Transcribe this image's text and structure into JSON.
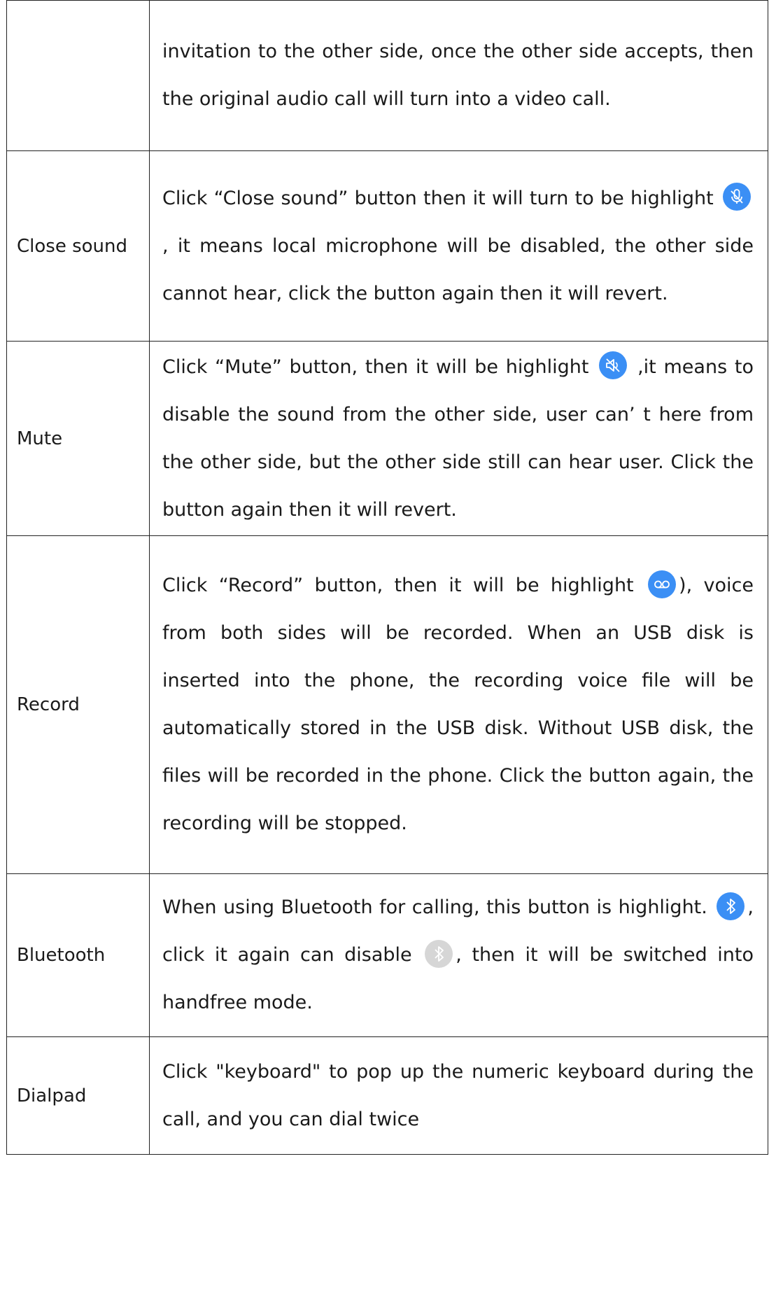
{
  "rows": [
    {
      "feature": "",
      "text": "invitation to the other side, once the other side accepts, then the original audio call will turn into a video call."
    },
    {
      "feature": "Close sound",
      "text_before": "Click “Close sound” button then it will turn to be highlight",
      "text_after": ", it means local microphone will be disabled, the other side cannot hear, click the button again then it will revert."
    },
    {
      "feature": "Mute",
      "text_before": "Click  “Mute” button, then it will be highlight",
      "text_after": ",it means to disable the sound from the other side, user can’ t here from the other side, but the other side still can hear user. Click the button again then it will revert."
    },
    {
      "feature": "Record",
      "text_before": "Click  “Record” button, then it will be highlight",
      "text_after": "), voice from both sides will be recorded. When an USB disk is inserted into the phone, the recording voice file will be automatically stored in the USB disk. Without USB disk, the files will be recorded in the phone. Click the button again, the recording will be stopped."
    },
    {
      "feature": "Bluetooth",
      "text_before": "When using Bluetooth for calling, this button is highlight.",
      "text_middle": ", click it again can disable",
      "text_after": ", then it will be switched into handfree mode."
    },
    {
      "feature": "Dialpad",
      "text": "Click \"keyboard\" to pop up the numeric keyboard during the call, and you can dial twice"
    }
  ],
  "icons": {
    "close_sound": "mic-off-icon",
    "mute": "speaker-mute-icon",
    "record": "voicemail-icon",
    "bluetooth_on": "bluetooth-icon",
    "bluetooth_off": "bluetooth-icon",
    "highlight_color": "#3b8ff5",
    "disabled_color": "#d6d6d6"
  }
}
